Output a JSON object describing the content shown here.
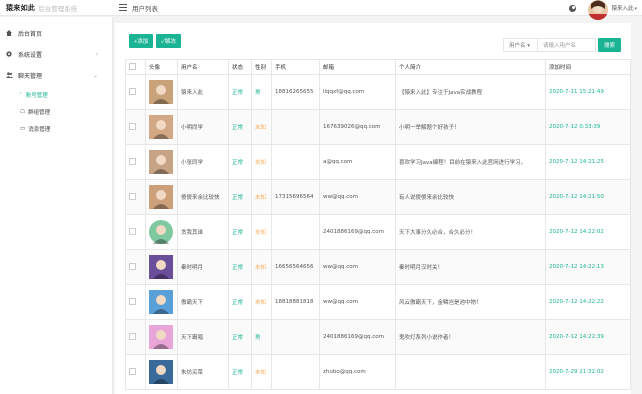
{
  "header": {
    "logo_text": "猿来如此",
    "system_name": "后台管理系统",
    "breadcrumb": "用户列表",
    "user_name": "猿来入此",
    "caret": "▾"
  },
  "sidebar": {
    "items": [
      {
        "label": "后台首页",
        "icon": "home-icon"
      },
      {
        "label": "系统设置",
        "icon": "gear-icon",
        "arrow": "›"
      },
      {
        "label": "聊天管理",
        "icon": "users-icon",
        "arrow": "⌄"
      }
    ],
    "sub_items": [
      {
        "label": "账号管理",
        "icon": "user-manage-icon",
        "glyph": "ﾟ"
      },
      {
        "label": "群组管理",
        "icon": "group-icon",
        "glyph": "☖"
      },
      {
        "label": "消息管理",
        "icon": "message-icon",
        "glyph": "▭"
      }
    ]
  },
  "toolbar": {
    "add_label": "+添加",
    "disable_label": "✓解冻",
    "select_value": "用户名 ▾",
    "search_placeholder": "请输入用户名",
    "search_label": "搜索"
  },
  "table": {
    "headers": [
      "",
      "头像",
      "用户名",
      "状态",
      "性别",
      "手机",
      "邮箱",
      "个人简介",
      "添加时间"
    ],
    "rows": [
      {
        "name": "猿来入此",
        "status": "正常",
        "gender": "男",
        "phone": "18816265655",
        "email": "llqqxf@qq.com",
        "bio": "【猿来入此】专注于Java实战教程",
        "date": "2020-7-11 15:21:49",
        "avatar_color": "#c8a27a",
        "avatar_round": false
      },
      {
        "name": "小明同学",
        "status": "正常",
        "gender": "未知",
        "phone": "",
        "email": "167639026@qq.com",
        "bio": "小明一举解题个好孩子！",
        "date": "2020-7-12 0:33:39",
        "avatar_color": "#d3a884",
        "avatar_round": false
      },
      {
        "name": "小张同学",
        "status": "正常",
        "gender": "未知",
        "phone": "",
        "email": "a@qq.com",
        "bio": "喜欢学习Java编程！目前在猿来入此官网进行学习。",
        "date": "2020-7-12 14:21:25",
        "avatar_color": "#c7a386",
        "avatar_round": false
      },
      {
        "name": "傻傻来余比较快",
        "status": "正常",
        "gender": "未知",
        "phone": "17315696564",
        "email": "ww@qq.com",
        "bio": "有人说傻傻来余比较快",
        "date": "2020-7-12 14:21:50",
        "avatar_color": "#cda07c",
        "avatar_round": false
      },
      {
        "name": "贪我其谁",
        "status": "正常",
        "gender": "未知",
        "phone": "",
        "email": "2401886169@qq.com",
        "bio": "天下大事分久必合，合久必分！",
        "date": "2020-7-12 14:22:02",
        "avatar_color": "#7fc8a0",
        "avatar_round": true
      },
      {
        "name": "秦时明月",
        "status": "正常",
        "gender": "未知",
        "phone": "16656564656",
        "email": "ww@qq.com",
        "bio": "秦时明月汉时关！",
        "date": "2020-7-12 14:22:13",
        "avatar_color": "#6a4e9a",
        "avatar_round": false
      },
      {
        "name": "傲霸天下",
        "status": "正常",
        "gender": "未知",
        "phone": "18818881818",
        "email": "ww@qq.com",
        "bio": "风云傲霸天下，金鳞岂是池中物！",
        "date": "2020-7-12 14:22:22",
        "avatar_color": "#5aa0d8",
        "avatar_round": false
      },
      {
        "name": "天下霸唱",
        "status": "正常",
        "gender": "男",
        "phone": "",
        "email": "2401886169@qq.com",
        "bio": "鬼吹灯系列小说作者！",
        "date": "2020-7-12 14:22:39",
        "avatar_color": "#e8a6d8",
        "avatar_round": false
      },
      {
        "name": "朱坊买菜",
        "status": "正常",
        "gender": "未知",
        "phone": "",
        "email": "zhubo@qq.com",
        "bio": "",
        "date": "2020-7-29 21:32:02",
        "avatar_color": "#3a6a9a",
        "avatar_round": false
      }
    ]
  },
  "colors": {
    "accent": "#1ab394",
    "warn": "#f8ac59"
  }
}
